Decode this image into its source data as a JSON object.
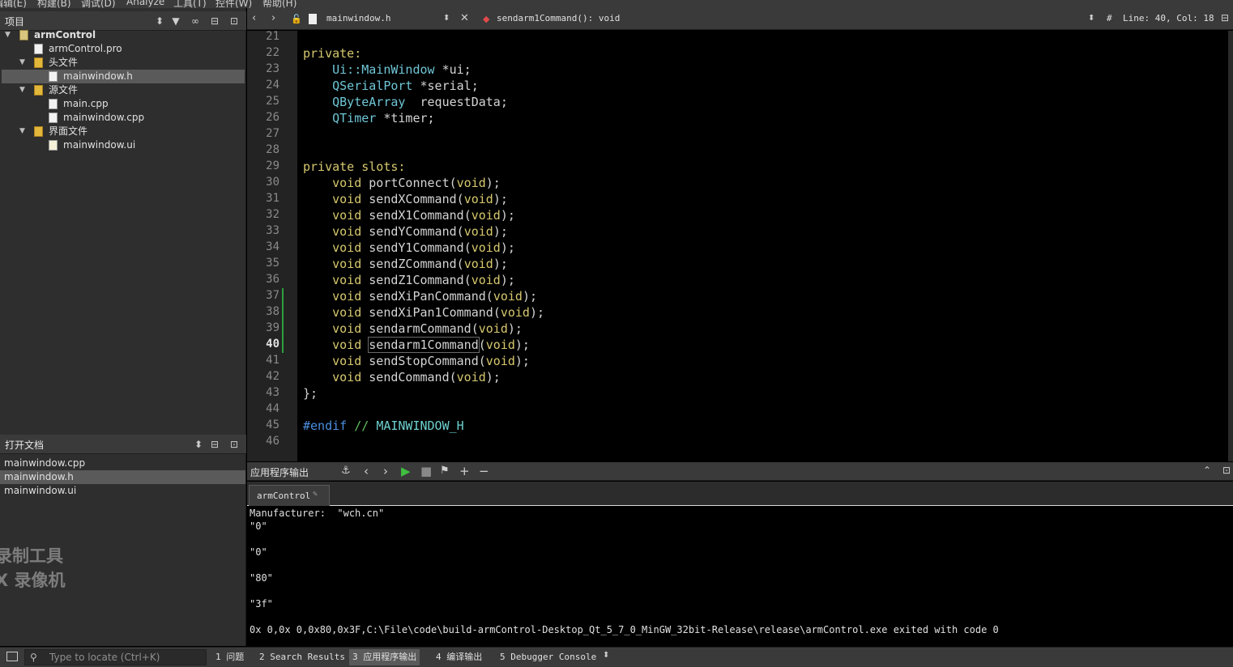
{
  "menubar": [
    "编辑(E)",
    "构建(B)",
    "调试(D)",
    "Analyze",
    "工具(T)",
    "控件(W)",
    "帮助(H)"
  ],
  "projects_panel": {
    "title": "项目",
    "tree": [
      {
        "label": "armControl",
        "kind": "project",
        "depth": 0,
        "expanded": true,
        "bold": true
      },
      {
        "label": "armControl.pro",
        "kind": "file",
        "depth": 1
      },
      {
        "label": "头文件",
        "kind": "folder",
        "depth": 1,
        "expanded": true
      },
      {
        "label": "mainwindow.h",
        "kind": "file",
        "depth": 2,
        "selected": true
      },
      {
        "label": "源文件",
        "kind": "folder",
        "depth": 1,
        "expanded": true
      },
      {
        "label": "main.cpp",
        "kind": "file",
        "depth": 2
      },
      {
        "label": "mainwindow.cpp",
        "kind": "file",
        "depth": 2
      },
      {
        "label": "界面文件",
        "kind": "folder",
        "depth": 1,
        "expanded": true
      },
      {
        "label": "mainwindow.ui",
        "kind": "ui",
        "depth": 2
      }
    ]
  },
  "open_docs": {
    "title": "打开文档",
    "items": [
      {
        "label": "mainwindow.cpp"
      },
      {
        "label": "mainwindow.h",
        "selected": true
      },
      {
        "label": "mainwindow.ui"
      }
    ]
  },
  "watermark": {
    "line1": "录制工具",
    "line2": "X 录像机"
  },
  "editor_toolbar": {
    "file": "mainwindow.h",
    "symbol": "sendarm1Command(): void",
    "hash": "#",
    "position": "Line: 40, Col: 18"
  },
  "editor": {
    "current_line": 40,
    "lines": [
      {
        "n": 21,
        "tokens": []
      },
      {
        "n": 22,
        "tokens": [
          {
            "t": "private:",
            "c": "kw"
          }
        ]
      },
      {
        "n": 23,
        "tokens": [
          {
            "t": "    "
          },
          {
            "t": "Ui::MainWindow",
            "c": "ty"
          },
          {
            "t": " *ui;",
            "c": "pu"
          }
        ]
      },
      {
        "n": 24,
        "tokens": [
          {
            "t": "    "
          },
          {
            "t": "QSerialPort",
            "c": "ty"
          },
          {
            "t": " *serial;",
            "c": "pu"
          }
        ]
      },
      {
        "n": 25,
        "tokens": [
          {
            "t": "    "
          },
          {
            "t": "QByteArray",
            "c": "ty"
          },
          {
            "t": "  requestData;",
            "c": "pu"
          }
        ]
      },
      {
        "n": 26,
        "tokens": [
          {
            "t": "    "
          },
          {
            "t": "QTimer",
            "c": "ty"
          },
          {
            "t": " *timer;",
            "c": "pu"
          }
        ]
      },
      {
        "n": 27,
        "tokens": []
      },
      {
        "n": 28,
        "tokens": []
      },
      {
        "n": 29,
        "tokens": [
          {
            "t": "private slots:",
            "c": "kw"
          }
        ]
      },
      {
        "n": 30,
        "tokens": [
          {
            "t": "    "
          },
          {
            "t": "void",
            "c": "kw"
          },
          {
            "t": " portConnect",
            "c": "fn"
          },
          {
            "t": "(",
            "c": "pu"
          },
          {
            "t": "void",
            "c": "kw"
          },
          {
            "t": ");",
            "c": "pu"
          }
        ]
      },
      {
        "n": 31,
        "tokens": [
          {
            "t": "    "
          },
          {
            "t": "void",
            "c": "kw"
          },
          {
            "t": " sendXCommand",
            "c": "fn"
          },
          {
            "t": "(",
            "c": "pu"
          },
          {
            "t": "void",
            "c": "kw"
          },
          {
            "t": ");",
            "c": "pu"
          }
        ]
      },
      {
        "n": 32,
        "tokens": [
          {
            "t": "    "
          },
          {
            "t": "void",
            "c": "kw"
          },
          {
            "t": " sendX1Command",
            "c": "fn"
          },
          {
            "t": "(",
            "c": "pu"
          },
          {
            "t": "void",
            "c": "kw"
          },
          {
            "t": ");",
            "c": "pu"
          }
        ]
      },
      {
        "n": 33,
        "tokens": [
          {
            "t": "    "
          },
          {
            "t": "void",
            "c": "kw"
          },
          {
            "t": " sendYCommand",
            "c": "fn"
          },
          {
            "t": "(",
            "c": "pu"
          },
          {
            "t": "void",
            "c": "kw"
          },
          {
            "t": ");",
            "c": "pu"
          }
        ]
      },
      {
        "n": 34,
        "tokens": [
          {
            "t": "    "
          },
          {
            "t": "void",
            "c": "kw"
          },
          {
            "t": " sendY1Command",
            "c": "fn"
          },
          {
            "t": "(",
            "c": "pu"
          },
          {
            "t": "void",
            "c": "kw"
          },
          {
            "t": ");",
            "c": "pu"
          }
        ]
      },
      {
        "n": 35,
        "tokens": [
          {
            "t": "    "
          },
          {
            "t": "void",
            "c": "kw"
          },
          {
            "t": " sendZCommand",
            "c": "fn"
          },
          {
            "t": "(",
            "c": "pu"
          },
          {
            "t": "void",
            "c": "kw"
          },
          {
            "t": ");",
            "c": "pu"
          }
        ]
      },
      {
        "n": 36,
        "tokens": [
          {
            "t": "    "
          },
          {
            "t": "void",
            "c": "kw"
          },
          {
            "t": " sendZ1Command",
            "c": "fn"
          },
          {
            "t": "(",
            "c": "pu"
          },
          {
            "t": "void",
            "c": "kw"
          },
          {
            "t": ");",
            "c": "pu"
          }
        ]
      },
      {
        "n": 37,
        "tokens": [
          {
            "t": "    "
          },
          {
            "t": "void",
            "c": "kw"
          },
          {
            "t": " sendXiPanCommand",
            "c": "fn"
          },
          {
            "t": "(",
            "c": "pu"
          },
          {
            "t": "void",
            "c": "kw"
          },
          {
            "t": ");",
            "c": "pu"
          }
        ]
      },
      {
        "n": 38,
        "tokens": [
          {
            "t": "    "
          },
          {
            "t": "void",
            "c": "kw"
          },
          {
            "t": " sendXiPan1Command",
            "c": "fn"
          },
          {
            "t": "(",
            "c": "pu"
          },
          {
            "t": "void",
            "c": "kw"
          },
          {
            "t": ");",
            "c": "pu"
          }
        ]
      },
      {
        "n": 39,
        "tokens": [
          {
            "t": "    "
          },
          {
            "t": "void",
            "c": "kw"
          },
          {
            "t": " sendarmCommand",
            "c": "fn"
          },
          {
            "t": "(",
            "c": "pu"
          },
          {
            "t": "void",
            "c": "kw"
          },
          {
            "t": ");",
            "c": "pu"
          }
        ]
      },
      {
        "n": 40,
        "tokens": [
          {
            "t": "    "
          },
          {
            "t": "void",
            "c": "kw"
          },
          {
            "t": " "
          },
          {
            "t": "sendarm1Command",
            "c": "fn",
            "hl": true
          },
          {
            "t": "(",
            "c": "pu"
          },
          {
            "t": "void",
            "c": "kw"
          },
          {
            "t": ");",
            "c": "pu"
          }
        ]
      },
      {
        "n": 41,
        "tokens": [
          {
            "t": "    "
          },
          {
            "t": "void",
            "c": "kw"
          },
          {
            "t": " sendStopCommand",
            "c": "fn"
          },
          {
            "t": "(",
            "c": "pu"
          },
          {
            "t": "void",
            "c": "kw"
          },
          {
            "t": ");",
            "c": "pu"
          }
        ]
      },
      {
        "n": 42,
        "tokens": [
          {
            "t": "    "
          },
          {
            "t": "void",
            "c": "kw"
          },
          {
            "t": " sendCommand",
            "c": "fn"
          },
          {
            "t": "(",
            "c": "pu"
          },
          {
            "t": "void",
            "c": "kw"
          },
          {
            "t": ");",
            "c": "pu"
          }
        ]
      },
      {
        "n": 43,
        "tokens": [
          {
            "t": "};",
            "c": "pu"
          }
        ]
      },
      {
        "n": 44,
        "tokens": []
      },
      {
        "n": 45,
        "tokens": [
          {
            "t": "#endif",
            "c": "pp"
          },
          {
            "t": " // ",
            "c": "cm"
          },
          {
            "t": "MAINWINDOW_H",
            "c": "mc"
          }
        ]
      },
      {
        "n": 46,
        "tokens": []
      }
    ]
  },
  "output": {
    "title": "应用程序输出",
    "tab": "armControl",
    "lines": [
      "Manufacturer:  \"wch.cn\"",
      "\"0\"",
      "",
      "\"0\"",
      "",
      "\"80\"",
      "",
      "\"3f\"",
      "",
      "0x 0,0x 0,0x80,0x3F,C:\\File\\code\\build-armControl-Desktop_Qt_5_7_0_MinGW_32bit-Release\\release\\armControl.exe exited with code 0"
    ]
  },
  "statusbar": {
    "locator_placeholder": "Type to locate (Ctrl+K)",
    "tabs": [
      {
        "label": "1 问题"
      },
      {
        "label": "2 Search Results"
      },
      {
        "label": "3 应用程序输出",
        "active": true
      },
      {
        "label": "4 编译输出"
      },
      {
        "label": "5 Debugger Console"
      }
    ]
  },
  "colors": {
    "panel_bg": "#2e2e2e",
    "toolbar_bg": "#3a3a3a",
    "selection": "#5a5a5a",
    "keyword": "#d6c86e",
    "type": "#6fc6d6",
    "preprocessor": "#4a8fe0",
    "comment": "#5fbf5f",
    "run_green": "#3fbf3f"
  }
}
